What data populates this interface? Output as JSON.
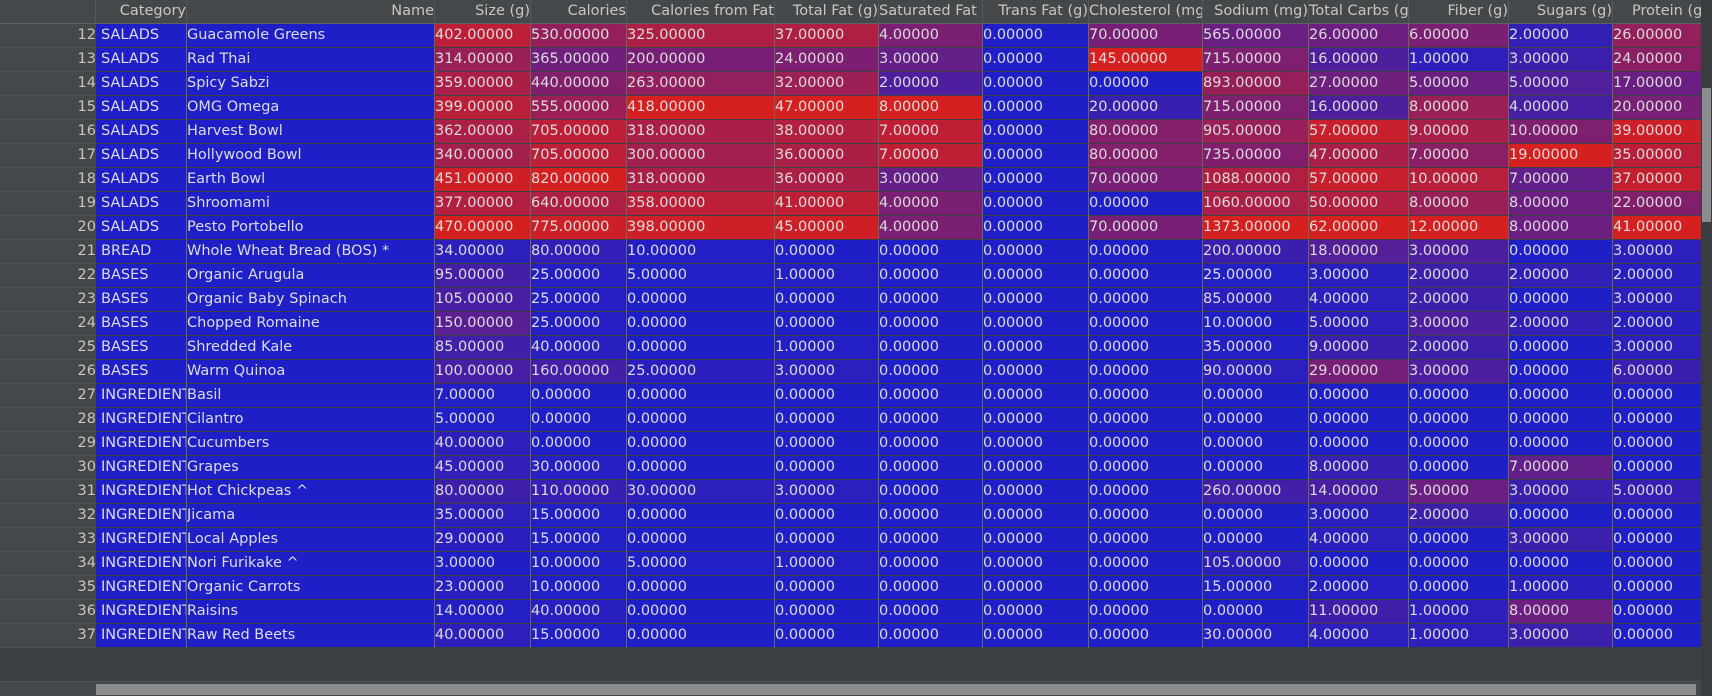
{
  "grid": {
    "index_header": "",
    "columns": [
      "Category",
      "Name",
      "Size (g)",
      "Calories",
      "Calories from Fat",
      "Total Fat (g)",
      "Saturated Fat (g)",
      "Trans Fat (g)",
      "Cholesterol (mg)",
      "Sodium (mg)",
      "Total Carbs (g)",
      "Fiber (g)",
      "Sugars (g)",
      "Protein (g)"
    ],
    "rows": [
      {
        "index": "12",
        "cells": [
          "SALADS",
          "Guacamole Greens",
          "402.00000",
          "530.00000",
          "325.00000",
          "37.00000",
          "4.00000",
          "0.00000",
          "70.00000",
          "565.00000",
          "26.00000",
          "6.00000",
          "2.00000",
          "26.00000"
        ]
      },
      {
        "index": "13",
        "cells": [
          "SALADS",
          "Rad Thai",
          "314.00000",
          "365.00000",
          "200.00000",
          "24.00000",
          "3.00000",
          "0.00000",
          "145.00000",
          "715.00000",
          "16.00000",
          "1.00000",
          "3.00000",
          "24.00000"
        ]
      },
      {
        "index": "14",
        "cells": [
          "SALADS",
          "Spicy Sabzi",
          "359.00000",
          "440.00000",
          "263.00000",
          "32.00000",
          "2.00000",
          "0.00000",
          "0.00000",
          "893.00000",
          "27.00000",
          "5.00000",
          "5.00000",
          "17.00000"
        ]
      },
      {
        "index": "15",
        "cells": [
          "SALADS",
          "OMG Omega",
          "399.00000",
          "555.00000",
          "418.00000",
          "47.00000",
          "8.00000",
          "0.00000",
          "20.00000",
          "715.00000",
          "16.00000",
          "8.00000",
          "4.00000",
          "20.00000"
        ]
      },
      {
        "index": "16",
        "cells": [
          "SALADS",
          "Harvest Bowl",
          "362.00000",
          "705.00000",
          "318.00000",
          "38.00000",
          "7.00000",
          "0.00000",
          "80.00000",
          "905.00000",
          "57.00000",
          "9.00000",
          "10.00000",
          "39.00000"
        ]
      },
      {
        "index": "17",
        "cells": [
          "SALADS",
          "Hollywood Bowl",
          "340.00000",
          "705.00000",
          "300.00000",
          "36.00000",
          "7.00000",
          "0.00000",
          "80.00000",
          "735.00000",
          "47.00000",
          "7.00000",
          "19.00000",
          "35.00000"
        ]
      },
      {
        "index": "18",
        "cells": [
          "SALADS",
          "Earth Bowl",
          "451.00000",
          "820.00000",
          "318.00000",
          "36.00000",
          "3.00000",
          "0.00000",
          "70.00000",
          "1088.00000",
          "57.00000",
          "10.00000",
          "7.00000",
          "37.00000"
        ]
      },
      {
        "index": "19",
        "cells": [
          "SALADS",
          "Shroomami",
          "377.00000",
          "640.00000",
          "358.00000",
          "41.00000",
          "4.00000",
          "0.00000",
          "0.00000",
          "1060.00000",
          "50.00000",
          "8.00000",
          "8.00000",
          "22.00000"
        ]
      },
      {
        "index": "20",
        "cells": [
          "SALADS",
          "Pesto Portobello",
          "470.00000",
          "775.00000",
          "398.00000",
          "45.00000",
          "4.00000",
          "0.00000",
          "70.00000",
          "1373.00000",
          "62.00000",
          "12.00000",
          "8.00000",
          "41.00000"
        ]
      },
      {
        "index": "21",
        "cells": [
          "BREAD",
          "Whole Wheat Bread (BOS) *",
          "34.00000",
          "80.00000",
          "10.00000",
          "0.00000",
          "0.00000",
          "0.00000",
          "0.00000",
          "200.00000",
          "18.00000",
          "3.00000",
          "0.00000",
          "3.00000"
        ]
      },
      {
        "index": "22",
        "cells": [
          "BASES",
          "Organic Arugula",
          "95.00000",
          "25.00000",
          "5.00000",
          "1.00000",
          "0.00000",
          "0.00000",
          "0.00000",
          "25.00000",
          "3.00000",
          "2.00000",
          "2.00000",
          "2.00000"
        ]
      },
      {
        "index": "23",
        "cells": [
          "BASES",
          "Organic Baby Spinach",
          "105.00000",
          "25.00000",
          "0.00000",
          "0.00000",
          "0.00000",
          "0.00000",
          "0.00000",
          "85.00000",
          "4.00000",
          "2.00000",
          "0.00000",
          "3.00000"
        ]
      },
      {
        "index": "24",
        "cells": [
          "BASES",
          "Chopped Romaine",
          "150.00000",
          "25.00000",
          "0.00000",
          "0.00000",
          "0.00000",
          "0.00000",
          "0.00000",
          "10.00000",
          "5.00000",
          "3.00000",
          "2.00000",
          "2.00000"
        ]
      },
      {
        "index": "25",
        "cells": [
          "BASES",
          "Shredded Kale",
          "85.00000",
          "40.00000",
          "0.00000",
          "1.00000",
          "0.00000",
          "0.00000",
          "0.00000",
          "35.00000",
          "9.00000",
          "2.00000",
          "0.00000",
          "3.00000"
        ]
      },
      {
        "index": "26",
        "cells": [
          "BASES",
          "Warm Quinoa",
          "100.00000",
          "160.00000",
          "25.00000",
          "3.00000",
          "0.00000",
          "0.00000",
          "0.00000",
          "90.00000",
          "29.00000",
          "3.00000",
          "0.00000",
          "6.00000"
        ]
      },
      {
        "index": "27",
        "cells": [
          "INGREDIENTS",
          "Basil",
          "7.00000",
          "0.00000",
          "0.00000",
          "0.00000",
          "0.00000",
          "0.00000",
          "0.00000",
          "0.00000",
          "0.00000",
          "0.00000",
          "0.00000",
          "0.00000"
        ]
      },
      {
        "index": "28",
        "cells": [
          "INGREDIENTS",
          "Cilantro",
          "5.00000",
          "0.00000",
          "0.00000",
          "0.00000",
          "0.00000",
          "0.00000",
          "0.00000",
          "0.00000",
          "0.00000",
          "0.00000",
          "0.00000",
          "0.00000"
        ]
      },
      {
        "index": "29",
        "cells": [
          "INGREDIENTS",
          "Cucumbers",
          "40.00000",
          "0.00000",
          "0.00000",
          "0.00000",
          "0.00000",
          "0.00000",
          "0.00000",
          "0.00000",
          "0.00000",
          "0.00000",
          "0.00000",
          "0.00000"
        ]
      },
      {
        "index": "30",
        "cells": [
          "INGREDIENTS",
          "Grapes",
          "45.00000",
          "30.00000",
          "0.00000",
          "0.00000",
          "0.00000",
          "0.00000",
          "0.00000",
          "0.00000",
          "8.00000",
          "0.00000",
          "7.00000",
          "0.00000"
        ]
      },
      {
        "index": "31",
        "cells": [
          "INGREDIENTS",
          "Hot Chickpeas ^",
          "80.00000",
          "110.00000",
          "30.00000",
          "3.00000",
          "0.00000",
          "0.00000",
          "0.00000",
          "260.00000",
          "14.00000",
          "5.00000",
          "3.00000",
          "5.00000"
        ]
      },
      {
        "index": "32",
        "cells": [
          "INGREDIENTS",
          "Jicama",
          "35.00000",
          "15.00000",
          "0.00000",
          "0.00000",
          "0.00000",
          "0.00000",
          "0.00000",
          "0.00000",
          "3.00000",
          "2.00000",
          "0.00000",
          "0.00000"
        ]
      },
      {
        "index": "33",
        "cells": [
          "INGREDIENTS",
          "Local Apples",
          "29.00000",
          "15.00000",
          "0.00000",
          "0.00000",
          "0.00000",
          "0.00000",
          "0.00000",
          "0.00000",
          "4.00000",
          "0.00000",
          "3.00000",
          "0.00000"
        ]
      },
      {
        "index": "34",
        "cells": [
          "INGREDIENTS",
          "Nori Furikake ^",
          "3.00000",
          "10.00000",
          "5.00000",
          "1.00000",
          "0.00000",
          "0.00000",
          "0.00000",
          "105.00000",
          "0.00000",
          "0.00000",
          "0.00000",
          "0.00000"
        ]
      },
      {
        "index": "35",
        "cells": [
          "INGREDIENTS",
          "Organic Carrots",
          "23.00000",
          "10.00000",
          "0.00000",
          "0.00000",
          "0.00000",
          "0.00000",
          "0.00000",
          "15.00000",
          "2.00000",
          "0.00000",
          "1.00000",
          "0.00000"
        ]
      },
      {
        "index": "36",
        "cells": [
          "INGREDIENTS",
          "Raisins",
          "14.00000",
          "40.00000",
          "0.00000",
          "0.00000",
          "0.00000",
          "0.00000",
          "0.00000",
          "0.00000",
          "11.00000",
          "1.00000",
          "8.00000",
          "0.00000"
        ]
      },
      {
        "index": "37",
        "cells": [
          "INGREDIENTS",
          "Raw Red Beets",
          "40.00000",
          "15.00000",
          "0.00000",
          "0.00000",
          "0.00000",
          "0.00000",
          "0.00000",
          "30.00000",
          "4.00000",
          "1.00000",
          "3.00000",
          "0.00000"
        ]
      }
    ],
    "heatmap": {
      "low_color": "#1f1fc8",
      "high_color": "#d61f1f",
      "text_color": "#dcdcdc",
      "maxima": [
        0,
        0,
        470,
        820,
        418,
        47,
        8,
        1,
        145,
        1373,
        62,
        12,
        19,
        41
      ]
    },
    "colors": {
      "background": "#3d4043",
      "header_background": "#45484b",
      "header_text": "#c8c6c0",
      "grid_line": "#6b6a5a",
      "scrollbar_thumb": "#8b8d8f"
    }
  }
}
